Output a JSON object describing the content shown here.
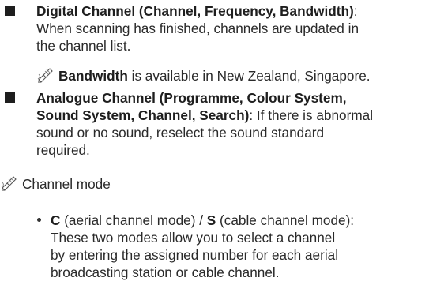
{
  "items": [
    {
      "title": "Digital Channel (Channel, Frequency, Bandwidth)",
      "after_title": ":",
      "desc_lines": [
        "When scanning has finished, channels are updated in",
        "the channel list."
      ],
      "note": {
        "icon": "note-pencil-icon",
        "bold": "Bandwidth",
        "text": " is available in New Zealand, Singapore."
      }
    },
    {
      "title_lines": [
        "Analogue Channel (Programme, Colour System,",
        "Sound System, Channel, Search)"
      ],
      "after_title": ": If there is abnormal",
      "desc_lines": [
        "sound or no sound, reselect the sound standard",
        "required."
      ]
    }
  ],
  "channel_mode": {
    "icon": "note-pencil-icon",
    "label": "Channel mode",
    "bullet": {
      "c_key": "C",
      "c_text": " (aerial channel mode) / ",
      "s_key": "S",
      "s_text": " (cable channel mode):",
      "lines": [
        "These two modes allow you to select a channel",
        "by entering the assigned number for each aerial",
        "broadcasting station or cable channel."
      ]
    }
  }
}
